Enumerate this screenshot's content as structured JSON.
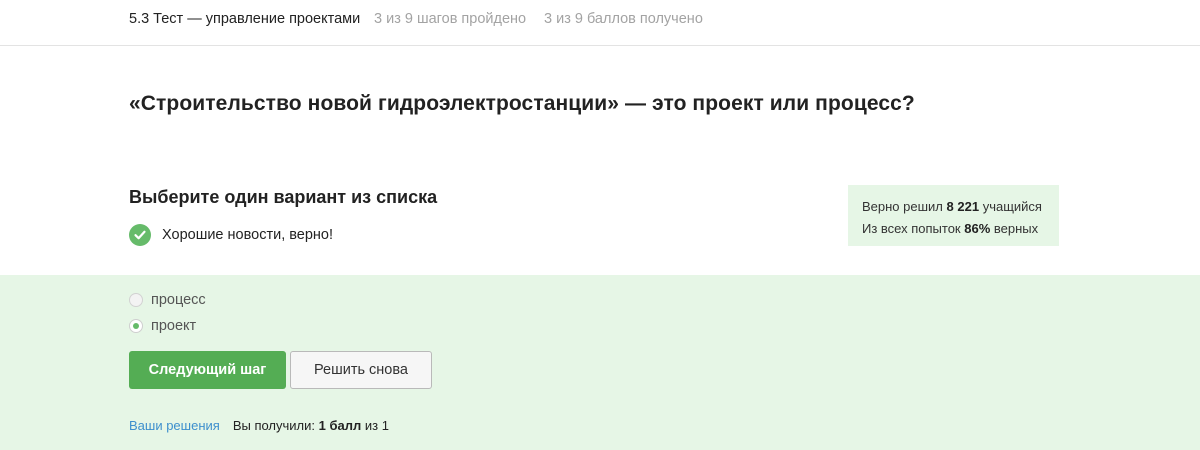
{
  "header": {
    "lesson_title": "5.3 Тест — управление проектами",
    "steps_progress": "3 из 9 шагов пройдено",
    "points_progress": "3 из 9 баллов  получено"
  },
  "question": {
    "text": "«Строительство новой гидроэлектростанции» — это проект или процесс?",
    "instruction": "Выберите один вариант из списка"
  },
  "feedback": {
    "icon": "check-circle-icon",
    "text": "Хорошие новости, верно!",
    "color": "#66bb6a"
  },
  "stats": {
    "line1_prefix": "Верно решил",
    "solved_count": "8 221",
    "line1_suffix": "учащийся",
    "line2_prefix": "Из всех попыток",
    "percent": "86%",
    "line2_suffix": "верных"
  },
  "options": [
    {
      "label": "процесс",
      "selected": false
    },
    {
      "label": "проект",
      "selected": true
    }
  ],
  "buttons": {
    "next_label": "Следующий шаг",
    "retry_label": "Решить снова"
  },
  "footer": {
    "solutions_link": "Ваши решения",
    "result_prefix": "Вы получили:",
    "score": "1 балл",
    "result_suffix": "из 1"
  },
  "colors": {
    "accent_green": "#54ad54",
    "success_background": "#e6f6e6",
    "link_blue": "#3d8fcd"
  }
}
